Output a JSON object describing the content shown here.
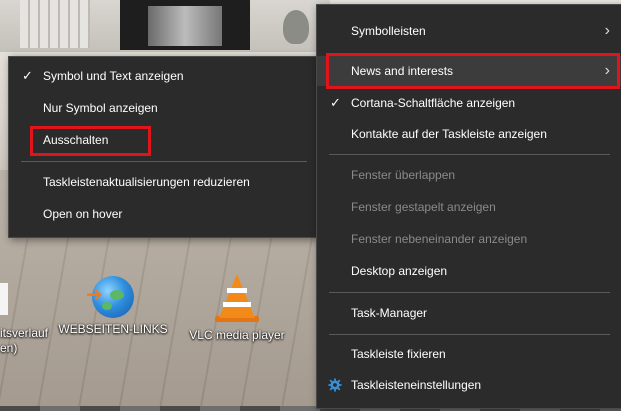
{
  "desktop": {
    "icons": [
      {
        "label_1": "itsverlauf",
        "label_2": "en)",
        "icon": "document-icon"
      },
      {
        "label": "WEBSEITEN-LINKS",
        "icon": "globe-shortcut-icon"
      },
      {
        "label": "VLC media player",
        "icon": "vlc-cone-icon"
      }
    ]
  },
  "news_submenu": {
    "items": [
      {
        "label": "Symbol und Text anzeigen",
        "checked": true
      },
      {
        "label": "Nur Symbol anzeigen"
      },
      {
        "label": "Ausschalten",
        "highlighted": true
      },
      {
        "label": "Taskleistenaktualisierungen reduzieren"
      },
      {
        "label": "Open on hover"
      }
    ]
  },
  "taskbar_menu": {
    "items": [
      {
        "label": "Symbolleisten",
        "submenu": true
      },
      {
        "label": "News and interests",
        "submenu": true,
        "highlighted": true
      },
      {
        "label": "Cortana-Schaltfläche anzeigen",
        "checked": true
      },
      {
        "label": "Kontakte auf der Taskleiste anzeigen"
      },
      {
        "label": "Fenster überlappen",
        "disabled": true
      },
      {
        "label": "Fenster gestapelt anzeigen",
        "disabled": true
      },
      {
        "label": "Fenster nebeneinander anzeigen",
        "disabled": true
      },
      {
        "label": "Desktop anzeigen"
      },
      {
        "label": "Task-Manager"
      },
      {
        "label": "Taskleiste fixieren"
      },
      {
        "label": "Taskleisteneinstellungen",
        "icon": "gear-icon"
      }
    ]
  },
  "glyphs": {
    "check": "✓",
    "chevron": "›"
  },
  "colors": {
    "menu_bg": "#2b2b2b",
    "highlight_border": "#e0151b",
    "disabled_text": "#8a8a8a"
  }
}
